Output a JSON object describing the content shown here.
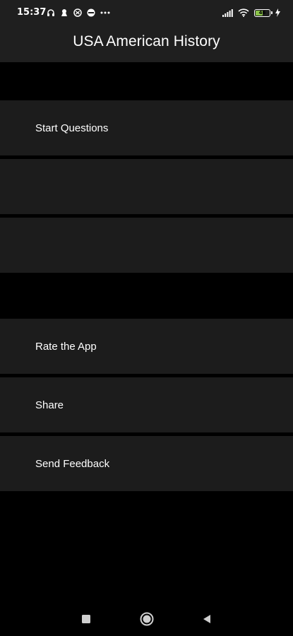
{
  "status_bar": {
    "time": "15:37",
    "battery": "46",
    "left_icons": [
      "headphones-icon",
      "notification-icon",
      "app-icon",
      "app-icon-2",
      "more-dots-icon"
    ],
    "right_icons": [
      "signal-icon",
      "wifi-icon",
      "battery-icon",
      "charging-icon"
    ]
  },
  "app_bar": {
    "title": "USA American History"
  },
  "menu": {
    "items": [
      {
        "label": "Start Questions"
      },
      {
        "label": ""
      },
      {
        "label": ""
      },
      {
        "label": "Rate the App"
      },
      {
        "label": "Share"
      },
      {
        "label": "Send Feedback"
      }
    ]
  },
  "nav_bar": {
    "buttons": [
      "recents-square-icon",
      "home-circle-icon",
      "back-triangle-icon"
    ]
  },
  "colors": {
    "background": "#000000",
    "bar": "#1f1f1f",
    "row": "#1c1c1c",
    "text": "#ffffff"
  }
}
